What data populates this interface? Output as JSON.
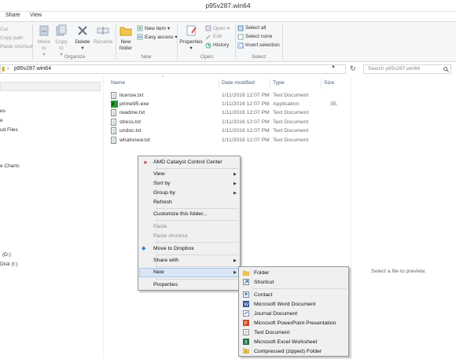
{
  "window": {
    "title": "p95v287.win64"
  },
  "tabs": [
    "Share",
    "View"
  ],
  "ribbon": {
    "clipboard": {
      "cut": "Cut",
      "copy_path": "Copy path",
      "paste_shortcut": "Paste shortcut"
    },
    "organize": {
      "label": "Organize",
      "move_to": "Move to",
      "copy_to": "Copy to",
      "delete": "Delete",
      "rename": "Rename"
    },
    "new": {
      "label": "New",
      "new_folder": "New folder",
      "new_item": "New item",
      "easy_access": "Easy access"
    },
    "open": {
      "label": "Open",
      "properties": "Properties",
      "open": "Open",
      "edit": "Edit",
      "history": "History"
    },
    "select": {
      "label": "Select",
      "select_all": "Select all",
      "select_none": "Select none",
      "invert_selection": "Invert selection"
    },
    "caret": "▾"
  },
  "address": {
    "path": "p95v287.win64",
    "separator": "›",
    "search_placeholder": "Search p95v287.win64"
  },
  "nav_items": [
    "es",
    "e",
    "ud Files",
    "e Charts",
    "(D:)",
    "Disk (I:)"
  ],
  "columns": {
    "name": "Name",
    "date": "Date modified",
    "type": "Type",
    "size": "Size"
  },
  "files": [
    {
      "name": "license.txt",
      "date": "1/11/2016 12:07 PM",
      "type": "Text Document",
      "size": ""
    },
    {
      "name": "prime95.exe",
      "date": "1/11/2016 12:07 PM",
      "type": "Application",
      "size": "35,"
    },
    {
      "name": "readme.txt",
      "date": "1/11/2016 12:07 PM",
      "type": "Text Document",
      "size": ""
    },
    {
      "name": "stress.txt",
      "date": "1/11/2016 12:07 PM",
      "type": "Text Document",
      "size": ""
    },
    {
      "name": "undoc.txt",
      "date": "1/11/2016 12:07 PM",
      "type": "Text Document",
      "size": ""
    },
    {
      "name": "whatsnew.txt",
      "date": "1/11/2016 12:07 PM",
      "type": "Text Document",
      "size": ""
    }
  ],
  "preview": {
    "text": "Select a file to preview."
  },
  "context_menu": {
    "amd": "AMD Catalyst Control Center",
    "view": "View",
    "sort_by": "Sort by",
    "group_by": "Group by",
    "refresh": "Refresh",
    "customize": "Customize this folder...",
    "paste": "Paste",
    "paste_shortcut": "Paste shortcut",
    "dropbox": "Move to Dropbox",
    "share_with": "Share with",
    "new": "New",
    "properties": "Properties",
    "arrow": "▶"
  },
  "new_submenu": {
    "folder": "Folder",
    "shortcut": "Shortcut",
    "contact": "Contact",
    "word": "Microsoft Word Document",
    "journal": "Journal Document",
    "powerpoint": "Microsoft PowerPoint Presentation",
    "text": "Text Document",
    "excel": "Microsoft Excel Worksheet",
    "zip": "Compressed (zipped) Folder"
  }
}
